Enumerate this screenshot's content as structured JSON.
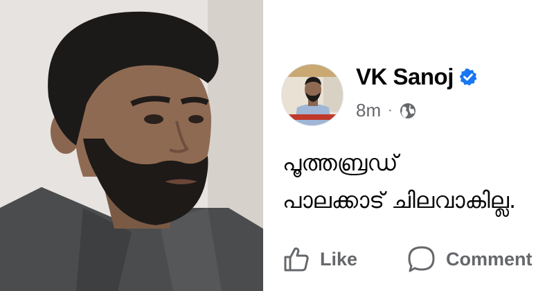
{
  "colors": {
    "accent": "#1877f2",
    "text_primary": "#050505",
    "text_secondary": "#65676b"
  },
  "post": {
    "author_name": "VK Sanoj",
    "verified_icon": "verified-badge-icon",
    "timestamp": "8m",
    "separator": "·",
    "privacy_icon": "globe-icon",
    "text_lines": [
      "പൂത്തബ്രഡ്",
      "പാലക്കാട് ചിലവാകില്ല."
    ],
    "actions": {
      "like_label": "Like",
      "comment_label": "Comment"
    }
  }
}
